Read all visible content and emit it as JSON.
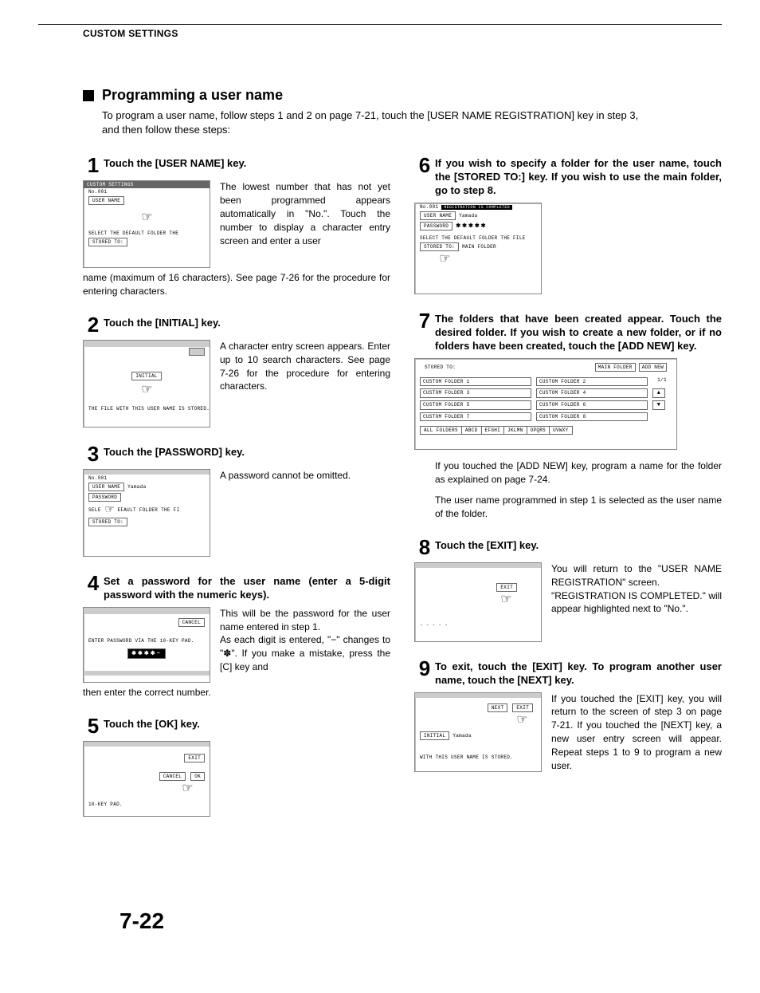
{
  "header": "CUSTOM SETTINGS",
  "section_marker": "■",
  "section_title": "Programming a user name",
  "intro": "To program a user name, follow steps 1 and 2 on page 7-21, touch the [USER NAME REGISTRATION] key in step 3, and then follow these steps:",
  "page_number": "7-22",
  "steps": {
    "s1": {
      "num": "1",
      "head": "Touch the [USER NAME] key.",
      "body": "The lowest number that has not yet been programmed appears automatically in \"No.\". Touch the number to display a character entry screen and enter a user",
      "after": "name (maximum of 16 characters). See page 7-26 for the procedure for entering characters.",
      "mock": {
        "title": "CUSTOM SETTINGS",
        "no": "No.001",
        "user": "USER NAME",
        "line": "SELECT THE DEFAULT FOLDER THE",
        "stored": "STORED TO:"
      }
    },
    "s2": {
      "num": "2",
      "head": "Touch the [INITIAL] key.",
      "body": "A character entry screen appears. Enter up to 10 search characters. See page 7-26 for the procedure for entering characters.",
      "mock": {
        "initial": "INITIAL",
        "line": "THE FILE WITH THIS USER NAME IS STORED."
      }
    },
    "s3": {
      "num": "3",
      "head": "Touch the [PASSWORD] key.",
      "body": "A password cannot be omitted.",
      "mock": {
        "no": "No.001",
        "user": "USER NAME",
        "userval": "Yamada",
        "pass": "PASSWORD",
        "sel": "SELE",
        "sel2": "EFAULT FOLDER THE FI",
        "stored": "STORED TO:"
      }
    },
    "s4": {
      "num": "4",
      "head": "Set a password for the user name (enter a 5-digit password with the numeric keys).",
      "body": "This will be the password for the user name entered in step 1.\nAs each digit is entered, \"−\" changes to \"✽\". If you make a mistake, press the [C] key and",
      "after": "then enter the correct number.",
      "mock": {
        "cancel": "CANCEL",
        "line": "ENTER PASSWORD VIA THE 10-KEY PAD.",
        "stars": "✱✱✱✱−"
      }
    },
    "s5": {
      "num": "5",
      "head": "Touch the [OK] key.",
      "mock": {
        "exit": "EXIT",
        "cancel": "CANCEL",
        "ok": "OK",
        "pad": "10-KEY PAD."
      }
    },
    "s6": {
      "num": "6",
      "head": "If you wish to specify a folder for the user name, touch the [STORED TO:] key. If you wish to use the main folder, go to step 8.",
      "mock": {
        "top": "REGISTRATION IS COMPLETED",
        "no": "No.001",
        "user": "USER NAME",
        "userval": "Yamada",
        "pass": "PASSWORD",
        "passval": "✱✱✱✱✱",
        "line": "SELECT THE DEFAULT FOLDER THE FILE",
        "stored": "STORED TO:",
        "storedval": "MAIN FOLDER"
      }
    },
    "s7": {
      "num": "7",
      "head": "The folders that have been created appear. Touch the desired folder. If you wish to create a new folder, or if no folders have been created, touch the [ADD NEW] key.",
      "note1": "If you touched the [ADD NEW] key, program a name for the folder as explained on page 7-24.",
      "note2": "The user name programmed in step 1 is selected as the user name of the folder.",
      "mock": {
        "stored": "STORED TO:",
        "main": "MAIN FOLDER",
        "add": "ADD NEW",
        "folders": [
          "CUSTOM FOLDER 1",
          "CUSTOM FOLDER 2",
          "CUSTOM FOLDER 3",
          "CUSTOM FOLDER 4",
          "CUSTOM FOLDER 5",
          "CUSTOM FOLDER 6",
          "CUSTOM FOLDER 7",
          "CUSTOM FOLDER 8"
        ],
        "page": "1/1",
        "tabs": [
          "ALL FOLDERS",
          "ABCD",
          "EFGHI",
          "JKLMN",
          "OPQRS",
          "UVWXY"
        ]
      }
    },
    "s8": {
      "num": "8",
      "head": "Touch the [EXIT] key.",
      "body": "You will return to the \"USER NAME REGISTRATION\" screen.\n\"REGISTRATION IS COMPLETED.\" will appear highlighted next to \"No.\".",
      "mock": {
        "exit": "EXIT",
        "dashes": "- - - - -"
      }
    },
    "s9": {
      "num": "9",
      "head": "To exit, touch the [EXIT] key. To program another user name, touch the [NEXT] key.",
      "body": "If you touched the [EXIT] key, you will return to the screen of step 3 on page 7-21. If you touched the [NEXT] key, a new user entry screen will appear. Repeat steps 1 to 9 to program a new user.",
      "mock": {
        "next": "NEXT",
        "exit": "EXIT",
        "initial": "INITIAL",
        "initialval": "Yamada",
        "line": "WITH THIS USER NAME IS STORED."
      }
    }
  }
}
